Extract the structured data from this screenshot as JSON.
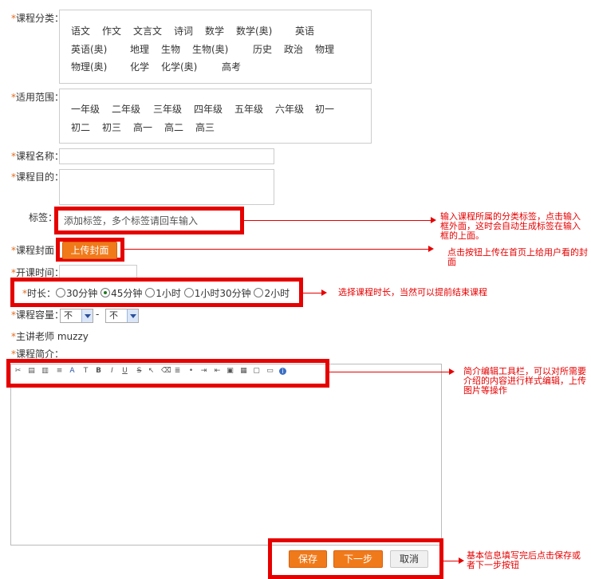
{
  "fields": {
    "category": {
      "label": "课程分类：",
      "rows": [
        [
          "语文",
          "作文",
          "文言文",
          "诗词",
          "数学",
          "数学(奥)",
          "英语"
        ],
        [
          "英语(奥)",
          "地理",
          "生物",
          "生物(奥)",
          "历史",
          "政治",
          "物理"
        ],
        [
          "物理(奥)",
          "化学",
          "化学(奥)",
          "高考"
        ]
      ]
    },
    "scope": {
      "label": "适用范围：",
      "rows": [
        [
          "一年级",
          "二年级",
          "三年级",
          "四年级",
          "五年级",
          "六年级",
          "初一"
        ],
        [
          "初二",
          "初三",
          "高一",
          "高二",
          "高三"
        ]
      ]
    },
    "name": {
      "label": "课程名称："
    },
    "goal": {
      "label": "课程目的："
    },
    "tags": {
      "label": "标签：",
      "placeholder": "添加标签，多个标签请回车输入"
    },
    "cover": {
      "label": "课程封面",
      "button": "上传封面"
    },
    "start_time": {
      "label": "开课时间："
    },
    "duration": {
      "label": "时长：",
      "options": [
        "30分钟",
        "45分钟",
        "1小时",
        "1小时30分钟",
        "2小时"
      ],
      "selected": "45分钟"
    },
    "capacity": {
      "label": "课程容量：",
      "min": "不",
      "sep": "-",
      "max": "不"
    },
    "teacher": {
      "label": "主讲老师",
      "value": "muzzy"
    },
    "intro": {
      "label": "课程简介："
    }
  },
  "buttons": {
    "save": "保存",
    "next": "下一步",
    "cancel": "取消"
  },
  "annotations": {
    "tags": "输入课程所属的分类标签，点击输入框外面，这时会自动生成标签在输入框的上面。",
    "cover": "点击按钮上传在首页上给用户看的封面",
    "duration": "选择课程时长，当然可以提前结束课程",
    "toolbar": "简介编辑工具栏，可以对所需要介绍的内容进行样式编辑，上传图片等操作",
    "buttons": "基本信息填写完后点击保存或者下一步按钮"
  },
  "toolbar_icons": [
    "cut-icon",
    "copy-icon",
    "paste-icon",
    "align-icon",
    "font-color-icon",
    "font-size-icon",
    "bold-icon",
    "italic-icon",
    "underline-icon",
    "strikethrough-icon",
    "pointer-icon",
    "eraser-icon",
    "list-icon",
    "bullet-list-icon",
    "indent-icon",
    "outdent-icon",
    "image-icon",
    "table-icon",
    "preview-icon",
    "media-icon",
    "info-icon"
  ],
  "colors": {
    "accent_red": "#e60000",
    "star_orange": "#e46b1f",
    "button_orange": "#f07a1a"
  }
}
